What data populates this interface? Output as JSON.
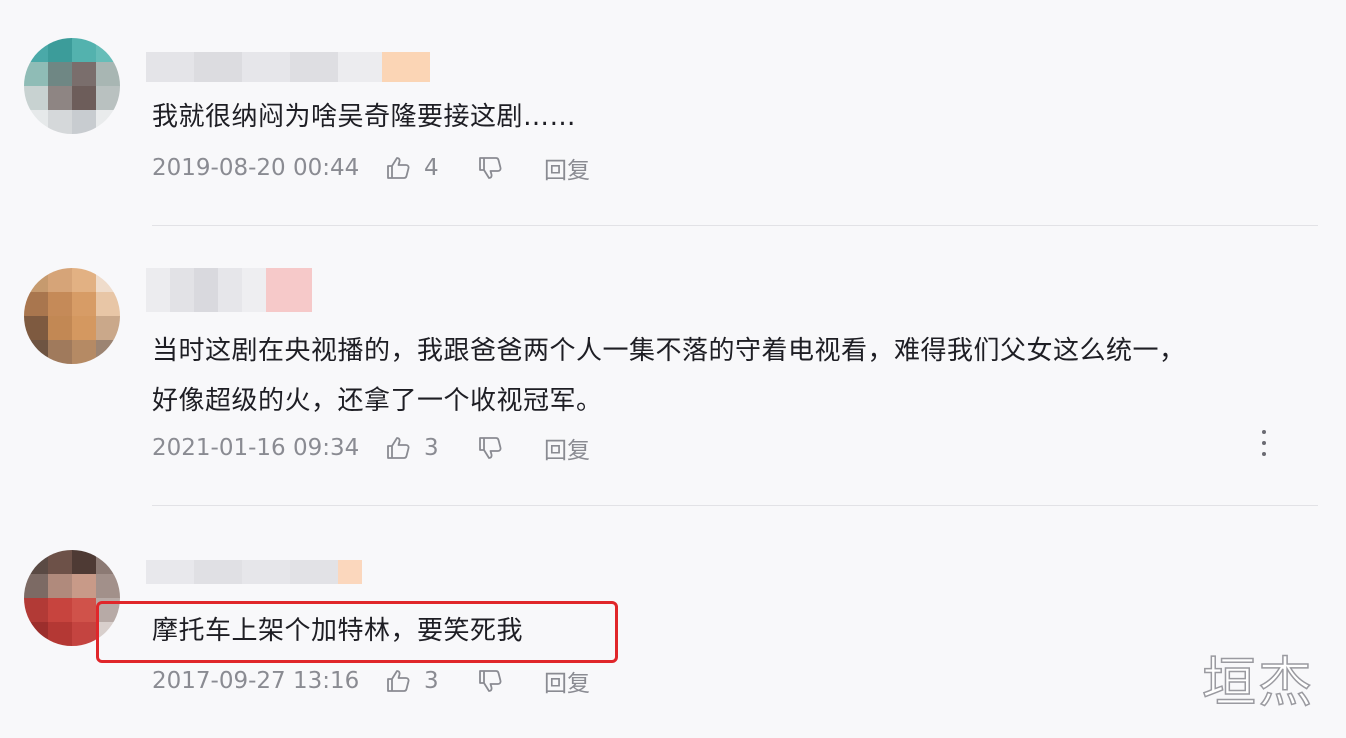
{
  "comments": [
    {
      "text": "我就很纳闷为啥吴奇隆要接这剧……",
      "time": "2019-08-20 00:44",
      "likes": "4",
      "reply_label": "回复"
    },
    {
      "text_line1": "当时这剧在央视播的，我跟爸爸两个人一集不落的守着电视看，难得我们父女这么统一，",
      "text_line2": "好像超级的火，还拿了一个收视冠军。",
      "time": "2021-01-16 09:34",
      "likes": "3",
      "reply_label": "回复"
    },
    {
      "text": "摩托车上架个加特林，要笑死我",
      "time": "2017-09-27 13:16",
      "likes": "3",
      "reply_label": "回复"
    }
  ],
  "watermark": "垣杰",
  "colors": {
    "highlight_border": "#e0262a",
    "meta_text": "#8a8b92",
    "body_text": "#1e1e24"
  },
  "icons": [
    "thumbs-up-icon",
    "thumbs-down-icon",
    "more-vertical-icon"
  ]
}
